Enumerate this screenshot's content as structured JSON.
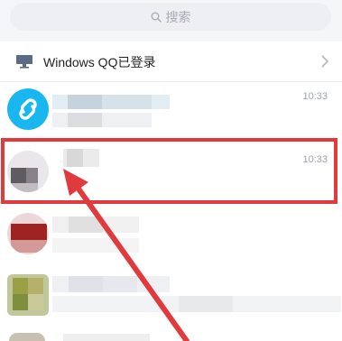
{
  "search": {
    "placeholder": "搜索"
  },
  "login_banner": {
    "label": "Windows QQ已登录"
  },
  "conversations": [
    {
      "time": "10:33"
    },
    {
      "time": "10:33"
    },
    {
      "time": ""
    },
    {
      "time": ""
    }
  ],
  "colors": {
    "highlight": "#e13a3d",
    "accent": "#19b7f0"
  }
}
